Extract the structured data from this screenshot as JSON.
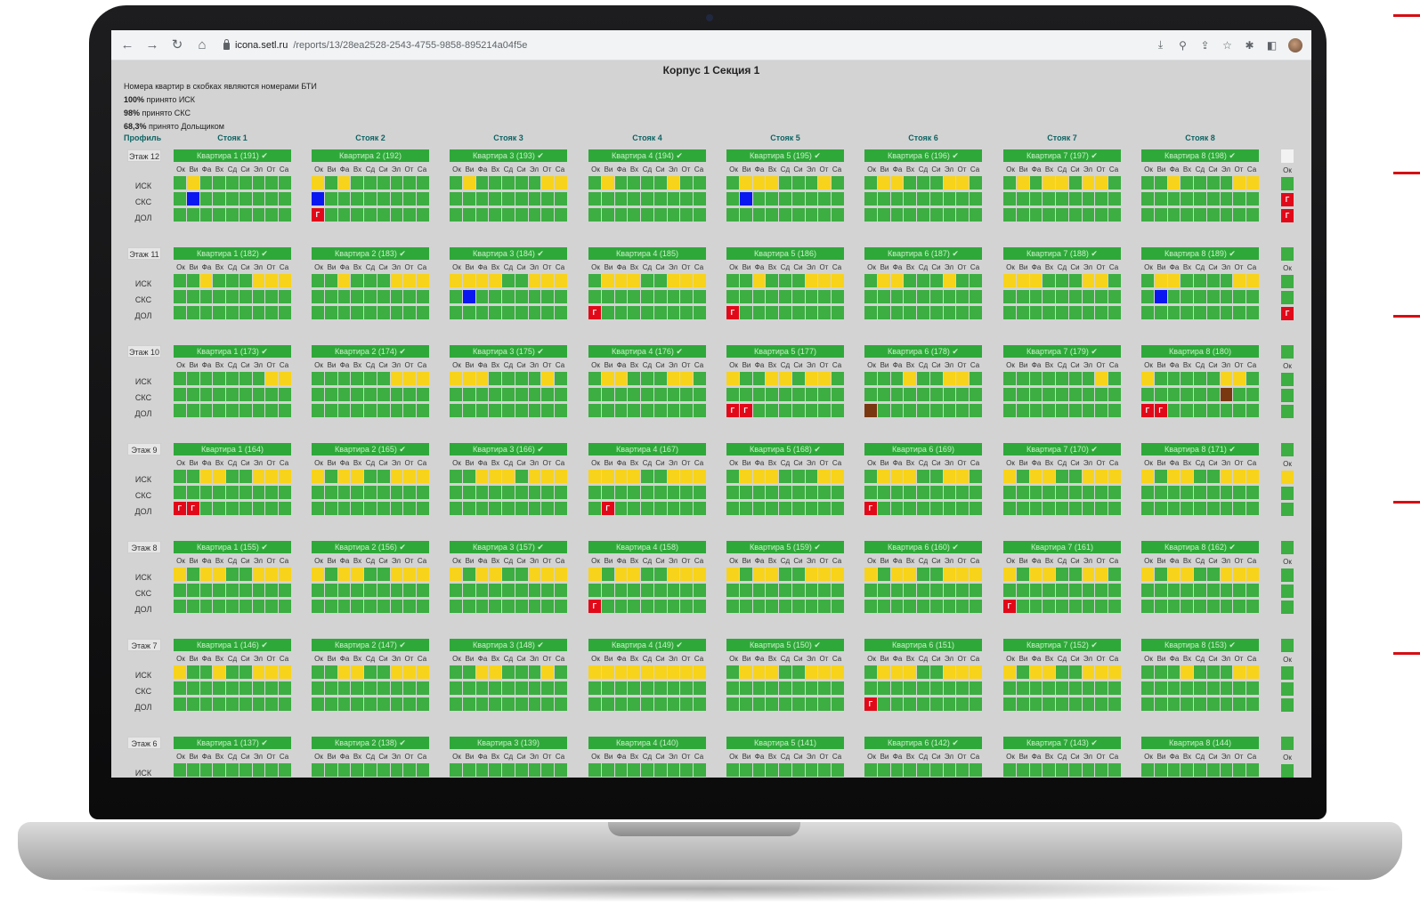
{
  "browser": {
    "url_host": "icona.setl.ru",
    "url_path": "/reports/13/28ea2528-2543-4755-9858-895214a04f5e",
    "nav": {
      "back": "←",
      "forward": "→",
      "reload": "↻",
      "home": "⌂"
    },
    "tools": {
      "download": "⤓",
      "zoom": "⚲",
      "share": "⇪",
      "star": "☆",
      "extensions": "✱",
      "sidebar": "◧"
    }
  },
  "page": {
    "title": "Корпус 1 Секция 1",
    "notes": {
      "bti": "Номера квартир в скобках являются номерами БТИ",
      "isk_value": "100%",
      "isk_text": "принято ИСК",
      "sks_value": "98%",
      "sks_text": "принято СКС",
      "dol_value": "68,3%",
      "dol_text": "принято Дольщиком"
    }
  },
  "grid": {
    "profile_label": "Профиль",
    "stoyaks": [
      "Стояк 1",
      "Стояк 2",
      "Стояк 3",
      "Стояк 4",
      "Стояк 5",
      "Стояк 6",
      "Стояк 7",
      "Стояк 8"
    ],
    "columns": [
      "Ок",
      "Ви",
      "Фа",
      "Вх",
      "Сд",
      "Си",
      "Эл",
      "От",
      "Са"
    ],
    "row_labels": [
      "ИСК",
      "СКС",
      "ДОЛ"
    ],
    "legend": {
      "G": "#3cae42",
      "Y": "#f8d31b",
      "B": "#0b17f0",
      "R": "#e10919",
      "M": "#7a3810",
      "W": "#f2f2f2"
    },
    "floors": [
      {
        "label": "Этаж 12",
        "apartments": [
          {
            "title": "Квартира 1 (191) ✔",
            "rows": [
              "GYGGGGGGG",
              "GBGGGGGGG",
              "GGGGGGGGG"
            ]
          },
          {
            "title": "Квартира 2 (192)",
            "rows": [
              "YGYGGGGGG",
              "BGGGGGGGG",
              "RGGGGGGGG"
            ]
          },
          {
            "title": "Квартира 3 (193) ✔",
            "rows": [
              "GYGGGGGYY",
              "GGGGGGGGG",
              "GGGGGGGGG"
            ]
          },
          {
            "title": "Квартира 4 (194) ✔",
            "rows": [
              "GYGGGGYGG",
              "GGGGGGGGG",
              "GGGGGGGGG"
            ]
          },
          {
            "title": "Квартира 5 (195) ✔",
            "rows": [
              "GYYYGGGYG",
              "GBGGGGGGG",
              "GGGGGGGGG"
            ]
          },
          {
            "title": "Квартира 6 (196) ✔",
            "rows": [
              "GYYGGGYYG",
              "GGGGGGGGG",
              "GGGGGGGGG"
            ]
          },
          {
            "title": "Квартира 7 (197) ✔",
            "rows": [
              "GYGYYGYYG",
              "GGGGGGGGG",
              "GGGGGGGGG"
            ]
          },
          {
            "title": "Квартира 8 (198) ✔",
            "rows": [
              "GGYGGGGYY",
              "GGGGGGGGG",
              "GGGGGGGGG"
            ]
          }
        ]
      },
      {
        "label": "Этаж 11",
        "apartments": [
          {
            "title": "Квартира 1 (182) ✔",
            "rows": [
              "GGYGGGYYY",
              "GGGGGGGGG",
              "GGGGGGGGG"
            ]
          },
          {
            "title": "Квартира 2 (183) ✔",
            "rows": [
              "GGYGGGYYY",
              "GGGGGGGGG",
              "GGGGGGGGG"
            ]
          },
          {
            "title": "Квартира 3 (184) ✔",
            "rows": [
              "YYYYGGYYY",
              "GBGGGGGGG",
              "GGGGGGGGG"
            ]
          },
          {
            "title": "Квартира 4 (185)",
            "rows": [
              "GYYYGGYYY",
              "GGGGGGGGG",
              "RGGGGGGGG"
            ]
          },
          {
            "title": "Квартира 5 (186)",
            "rows": [
              "GGYGGGYYY",
              "GGGGGGGGG",
              "RGGGGGGGG"
            ]
          },
          {
            "title": "Квартира 6 (187) ✔",
            "rows": [
              "GYYGGGYGG",
              "GGGGGGGGG",
              "GGGGGGGGG"
            ]
          },
          {
            "title": "Квартира 7 (188) ✔",
            "rows": [
              "YYYGGGYYG",
              "GGGGGGGGG",
              "GGGGGGGGG"
            ]
          },
          {
            "title": "Квартира 8 (189) ✔",
            "rows": [
              "GYYGGGGYY",
              "GBGGGGGGG",
              "GGGGGGGGG"
            ]
          }
        ]
      },
      {
        "label": "Этаж 10",
        "apartments": [
          {
            "title": "Квартира 1 (173) ✔",
            "rows": [
              "GGGGGGGYY",
              "GGGGGGGGG",
              "GGGGGGGGG"
            ]
          },
          {
            "title": "Квартира 2 (174) ✔",
            "rows": [
              "GGGGGGYYY",
              "GGGGGGGGG",
              "GGGGGGGGG"
            ]
          },
          {
            "title": "Квартира 3 (175) ✔",
            "rows": [
              "YYYGGGGYG",
              "GGGGGGGGG",
              "GGGGGGGGG"
            ]
          },
          {
            "title": "Квартира 4 (176) ✔",
            "rows": [
              "GYYGGGYYG",
              "GGGGGGGGG",
              "GGGGGGGGG"
            ]
          },
          {
            "title": "Квартира 5 (177)",
            "rows": [
              "YGGYYGYYG",
              "GGGGGGGGG",
              "RRGGGGGGG"
            ]
          },
          {
            "title": "Квартира 6 (178) ✔",
            "rows": [
              "GGGYGGYYG",
              "GGGGGGGGG",
              "MGGGGGGGG"
            ]
          },
          {
            "title": "Квартира 7 (179) ✔",
            "rows": [
              "GGGGGGGYG",
              "GGGGGGGGG",
              "GGGGGGGGG"
            ]
          },
          {
            "title": "Квартира 8 (180)",
            "rows": [
              "YGGGGGYYG",
              "GGGGGGMGG",
              "RRGGGGGGG"
            ]
          }
        ]
      },
      {
        "label": "Этаж 9",
        "apartments": [
          {
            "title": "Квартира 1 (164)",
            "rows": [
              "GGYYGGYYY",
              "GGGGGGGGG",
              "RRGGGGGGG"
            ]
          },
          {
            "title": "Квартира 2 (165) ✔",
            "rows": [
              "YGYYGGYYY",
              "GGGGGGGGG",
              "GGGGGGGGG"
            ]
          },
          {
            "title": "Квартира 3 (166) ✔",
            "rows": [
              "GGYYYGYYY",
              "GGGGGGGGG",
              "GGGGGGGGG"
            ]
          },
          {
            "title": "Квартира 4 (167)",
            "rows": [
              "YYYYGGYYY",
              "GGGGGGGGG",
              "GRGGGGGGG"
            ]
          },
          {
            "title": "Квартира 5 (168) ✔",
            "rows": [
              "GYYYGGGYY",
              "GGGGGGGGG",
              "GGGGGGGGG"
            ]
          },
          {
            "title": "Квартира 6 (169)",
            "rows": [
              "GYYYGGYYG",
              "GGGGGGGGG",
              "RGGGGGGGG"
            ]
          },
          {
            "title": "Квартира 7 (170) ✔",
            "rows": [
              "YGYYGGYYY",
              "GGGGGGGGG",
              "GGGGGGGGG"
            ]
          },
          {
            "title": "Квартира 8 (171) ✔",
            "rows": [
              "YGYYGGYYY",
              "GGGGGGGGG",
              "GGGGGGGGG"
            ]
          }
        ]
      },
      {
        "label": "Этаж 8",
        "apartments": [
          {
            "title": "Квартира 1 (155) ✔",
            "rows": [
              "YGYYGGYYY",
              "GGGGGGGGG",
              "GGGGGGGGG"
            ]
          },
          {
            "title": "Квартира 2 (156) ✔",
            "rows": [
              "YGYYGGYYY",
              "GGGGGGGGG",
              "GGGGGGGGG"
            ]
          },
          {
            "title": "Квартира 3 (157) ✔",
            "rows": [
              "YGYYGGYYY",
              "GGGGGGGGG",
              "GGGGGGGGG"
            ]
          },
          {
            "title": "Квартира 4 (158)",
            "rows": [
              "YGYYGGYYY",
              "GGGGGGGGG",
              "RGGGGGGGG"
            ]
          },
          {
            "title": "Квартира 5 (159) ✔",
            "rows": [
              "YGYYGGYYY",
              "GGGGGGGGG",
              "GGGGGGGGG"
            ]
          },
          {
            "title": "Квартира 6 (160) ✔",
            "rows": [
              "YGYYGGYYY",
              "GGGGGGGGG",
              "GGGGGGGGG"
            ]
          },
          {
            "title": "Квартира 7 (161)",
            "rows": [
              "YGYYGGYYG",
              "GGGGGGGGG",
              "RGGGGGGGG"
            ]
          },
          {
            "title": "Квартира 8 (162) ✔",
            "rows": [
              "YGYYGGYYY",
              "GGGGGGGGG",
              "GGGGGGGGG"
            ]
          }
        ]
      },
      {
        "label": "Этаж 7",
        "apartments": [
          {
            "title": "Квартира 1 (146) ✔",
            "rows": [
              "YGGYGGYYY",
              "GGGGGGGGG",
              "GGGGGGGGG"
            ]
          },
          {
            "title": "Квартира 2 (147) ✔",
            "rows": [
              "GGYYGGYYY",
              "GGGGGGGGG",
              "GGGGGGGGG"
            ]
          },
          {
            "title": "Квартира 3 (148) ✔",
            "rows": [
              "GGYYGGGYG",
              "GGGGGGGGG",
              "GGGGGGGGG"
            ]
          },
          {
            "title": "Квартира 4 (149) ✔",
            "rows": [
              "YYYYYYYYY",
              "GGGGGGGGG",
              "GGGGGGGGG"
            ]
          },
          {
            "title": "Квартира 5 (150) ✔",
            "rows": [
              "GYYYGGYYY",
              "GGGGGGGGG",
              "GGGGGGGGG"
            ]
          },
          {
            "title": "Квартира 6 (151)",
            "rows": [
              "GYYYGGYYY",
              "GGGGGGGGG",
              "RGGGGGGGG"
            ]
          },
          {
            "title": "Квартира 7 (152) ✔",
            "rows": [
              "YGYYGGYYY",
              "GGGGGGGGG",
              "GGGGGGGGG"
            ]
          },
          {
            "title": "Квартира 8 (153) ✔",
            "rows": [
              "GGGYGGGYY",
              "GGGGGGGGG",
              "GGGGGGGGG"
            ]
          }
        ]
      },
      {
        "label": "Этаж 6",
        "apartments": [
          {
            "title": "Квартира 1 (137) ✔",
            "rows": [
              "GGGGGGGGG",
              "GGGGGGGGG",
              "GGGGGGGGG"
            ]
          },
          {
            "title": "Квартира 2 (138) ✔",
            "rows": [
              "GGGGGGGGG",
              "GGGGGGGGG",
              "GGGGGGGGG"
            ]
          },
          {
            "title": "Квартира 3 (139)",
            "rows": [
              "GGGGGGGGG",
              "GGGGGGGGG",
              "GGGGGGGGG"
            ]
          },
          {
            "title": "Квартира 4 (140)",
            "rows": [
              "GGGGGGGGG",
              "GGGGGGGGG",
              "GGGGGGGGG"
            ]
          },
          {
            "title": "Квартира 5 (141)",
            "rows": [
              "GGGGGGGGG",
              "GGGGGGGGG",
              "GGGGGGGGG"
            ]
          },
          {
            "title": "Квартира 6 (142) ✔",
            "rows": [
              "GGGGGGGGG",
              "GGGGGGGGG",
              "GGGGGGGGG"
            ]
          },
          {
            "title": "Квартира 7 (143) ✔",
            "rows": [
              "GGGGGGGGG",
              "GGGGGGGGG",
              "GGGGGGGGG"
            ]
          },
          {
            "title": "Квартира 8 (144)",
            "rows": [
              "GGGGGGGGG",
              "GGGGGGGGG",
              "GGGGGGGGG"
            ]
          }
        ]
      }
    ],
    "partial_column": {
      "col_label": "Ок",
      "cells": [
        [
          "W",
          "G",
          "R",
          "R"
        ],
        [
          "G",
          "G",
          "G",
          "R"
        ],
        [
          "G",
          "G",
          "G",
          "G"
        ],
        [
          "G",
          "Y",
          "G",
          "G"
        ],
        [
          "G",
          "G",
          "G",
          "G"
        ],
        [
          "G",
          "G",
          "G",
          "G"
        ],
        [
          "G",
          "G",
          "G",
          "G"
        ]
      ]
    }
  }
}
